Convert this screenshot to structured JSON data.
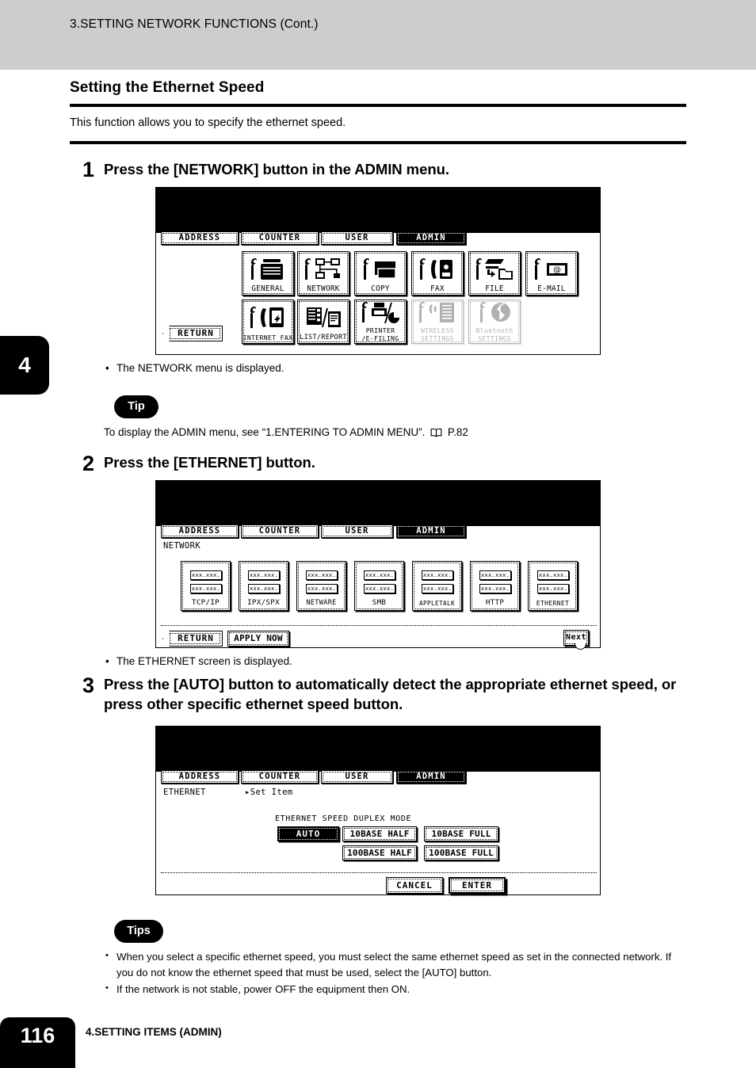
{
  "header": {
    "running_head": "3.SETTING NETWORK FUNCTIONS (Cont.)"
  },
  "chapter_tab": {
    "number": "4"
  },
  "section": {
    "title": "Setting the Ethernet Speed",
    "intro": "This function allows you to specify the ethernet speed."
  },
  "steps": [
    {
      "number": "1",
      "text": "Press the [NETWORK] button in the ADMIN menu.",
      "note": "The NETWORK menu is displayed."
    },
    {
      "number": "2",
      "text": "Press the [ETHERNET] button.",
      "note": "The ETHERNET screen is displayed."
    },
    {
      "number": "3",
      "text": "Press the [AUTO] button to automatically detect the appropriate ethernet speed, or press other specific ethernet speed button.",
      "note": ""
    }
  ],
  "tip": {
    "label": "Tip",
    "text_before": "To display the ADMIN menu, see “1.ENTERING TO ADMIN MENU”.",
    "page_ref": "P.82"
  },
  "tips": {
    "label": "Tips",
    "items": [
      "When you select a specific ethernet speed, you must select the same ethernet speed as set in the connected network.  If you do not know the ethernet speed that must be used, select the [AUTO] button.",
      "If the network is not stable, power OFF the equipment then ON."
    ]
  },
  "panel_tabs": [
    "ADDRESS",
    "COUNTER",
    "USER",
    "ADMIN"
  ],
  "panel_tabs_selected": "ADMIN",
  "admin_screen": {
    "row1": [
      {
        "label": "GENERAL",
        "icon": "wrench-copier-icon",
        "disabled": false
      },
      {
        "label": "NETWORK",
        "icon": "wrench-network-icon",
        "disabled": false
      },
      {
        "label": "COPY",
        "icon": "wrench-copy-icon",
        "disabled": false
      },
      {
        "label": "FAX",
        "icon": "wrench-fax-icon",
        "disabled": false
      },
      {
        "label": "FILE",
        "icon": "wrench-file-icon",
        "disabled": false
      },
      {
        "label": "E-MAIL",
        "icon": "wrench-email-icon",
        "disabled": false
      }
    ],
    "row2": [
      {
        "label": "INTERNET FAX",
        "label2": "",
        "icon": "wrench-internetfax-icon",
        "disabled": false
      },
      {
        "label": "LIST/REPORT",
        "label2": "",
        "icon": "list-report-icon",
        "disabled": false
      },
      {
        "label": "PRINTER",
        "label2": "/E-FILING",
        "icon": "wrench-printer-icon",
        "disabled": false
      },
      {
        "label": "WIRELESS",
        "label2": "SETTINGS",
        "icon": "wrench-wireless-icon",
        "disabled": true
      },
      {
        "label": "Bluetooth",
        "label2": "SETTINGS",
        "icon": "wrench-bluetooth-icon",
        "disabled": true
      }
    ],
    "return_label": "RETURN"
  },
  "network_screen": {
    "title": "NETWORK",
    "value_placeholder": "xxx.xxx.",
    "buttons": [
      "TCP/IP",
      "IPX/SPX",
      "NETWARE",
      "SMB",
      "APPLETALK",
      "HTTP",
      "ETHERNET"
    ],
    "return_label": "RETURN",
    "apply_label": "APPLY NOW",
    "next_label": "Next"
  },
  "ethernet_screen": {
    "title": "ETHERNET",
    "set_item": "Set Item",
    "group_label": "ETHERNET SPEED DUPLEX MODE",
    "options": [
      {
        "label": "AUTO",
        "selected": true
      },
      {
        "label": "10BASE HALF",
        "selected": false
      },
      {
        "label": "10BASE FULL",
        "selected": false
      },
      {
        "label": "100BASE HALF",
        "selected": false
      },
      {
        "label": "100BASE FULL",
        "selected": false
      }
    ],
    "cancel_label": "CANCEL",
    "enter_label": "ENTER"
  },
  "footer": {
    "page_number": "116",
    "text": "4.SETTING ITEMS (ADMIN)"
  }
}
